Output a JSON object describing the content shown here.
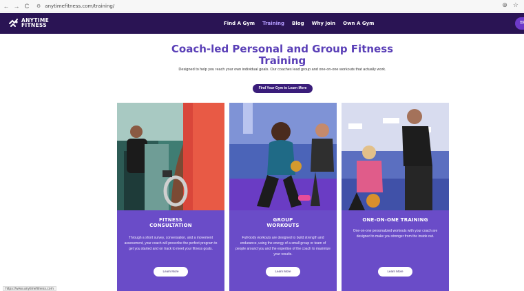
{
  "browser": {
    "back": "←",
    "forward": "→",
    "reload": "C",
    "url": "anytimefitness.com/training/",
    "zoom_icon": "⊕",
    "bookmark_icon": "☆"
  },
  "header": {
    "logo_line1": "ANYTIME",
    "logo_line2": "FITNESS",
    "nav": [
      {
        "label": "Find A Gym"
      },
      {
        "label": "Training"
      },
      {
        "label": "Blog"
      },
      {
        "label": "Why Join"
      },
      {
        "label": "Own A Gym"
      }
    ],
    "pill_label": "TR",
    "colors": {
      "header_bg": "#2a1454",
      "active_nav": "#b49cff",
      "brand_purple": "#5a3fb7",
      "card_bg": "#6a4cc8"
    }
  },
  "hero": {
    "title_line1": "Coach-led Personal and Group Fitness",
    "title_line2": "Training",
    "subtitle": "Designed to help you reach your own individual goals. Our coaches lead group and one-on-one workouts that actually work.",
    "cta": "Find Your Gym to Learn More"
  },
  "cards": [
    {
      "title_line1": "FITNESS",
      "title_line2": "CONSULTATION",
      "text": "Through a short survey, conversation, and a movement assessment, your coach will prescribe the perfect program to get you started and on track to meet your fitness goals.",
      "button": "Learn More"
    },
    {
      "title_line1": "GROUP",
      "title_line2": "WORKOUTS",
      "text": "Full-body workouts are designed to build strength and endurance, using the energy of a small group or team of people around you and the expertise of the coach to maximize your results.",
      "button": "Learn More"
    },
    {
      "title_line1": "ONE-ON-ONE TRAINING",
      "title_line2": "",
      "text": "One-on-one personalized workouts with your coach are designed to make you stronger from the inside out.",
      "button": "Learn More"
    }
  ],
  "status_bar": {
    "url": "https://www.anytimefitness.com"
  }
}
